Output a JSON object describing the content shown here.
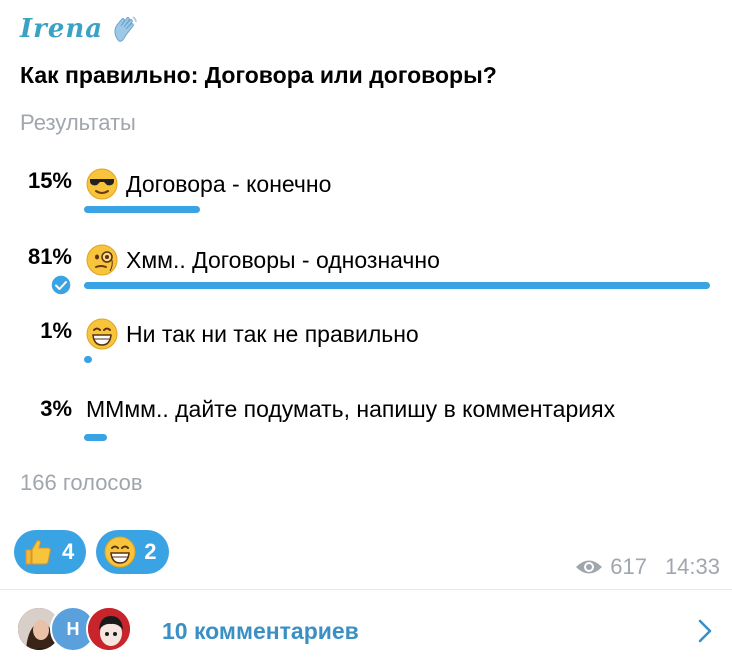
{
  "author": {
    "name": "Irena",
    "icon": "waving-hand-icon"
  },
  "poll": {
    "question": "Как правильно: Договора или договоры?",
    "type_label": "Результаты",
    "options": [
      {
        "percent_label": "15%",
        "percent": 15,
        "emoji": "sunglasses-face-icon",
        "text": "Договора - конечно",
        "chosen": false
      },
      {
        "percent_label": "81%",
        "percent": 81,
        "emoji": "monocle-face-icon",
        "text": "Хмм.. Договоры - однозначно",
        "chosen": true
      },
      {
        "percent_label": "1%",
        "percent": 1,
        "emoji": "grinning-face-icon",
        "text": "Ни так ни так не правильно",
        "chosen": false
      },
      {
        "percent_label": "3%",
        "percent": 3,
        "emoji": "",
        "text": "ММмм.. дайте подумать, напишу в комментариях",
        "chosen": false
      }
    ],
    "votes_label": "166 голосов"
  },
  "reactions": [
    {
      "icon": "thumbs-up-icon",
      "count": "4"
    },
    {
      "icon": "grinning-face-icon",
      "count": "2"
    }
  ],
  "meta": {
    "views_icon": "eye-icon",
    "views": "617",
    "time": "14:33"
  },
  "comments": {
    "label": "10 комментариев",
    "avatar_letter": "Н"
  },
  "colors": {
    "accent": "#3aa3e3",
    "author": "#3aa3c4",
    "muted": "#a0a6ad",
    "link": "#3a8fc4"
  }
}
